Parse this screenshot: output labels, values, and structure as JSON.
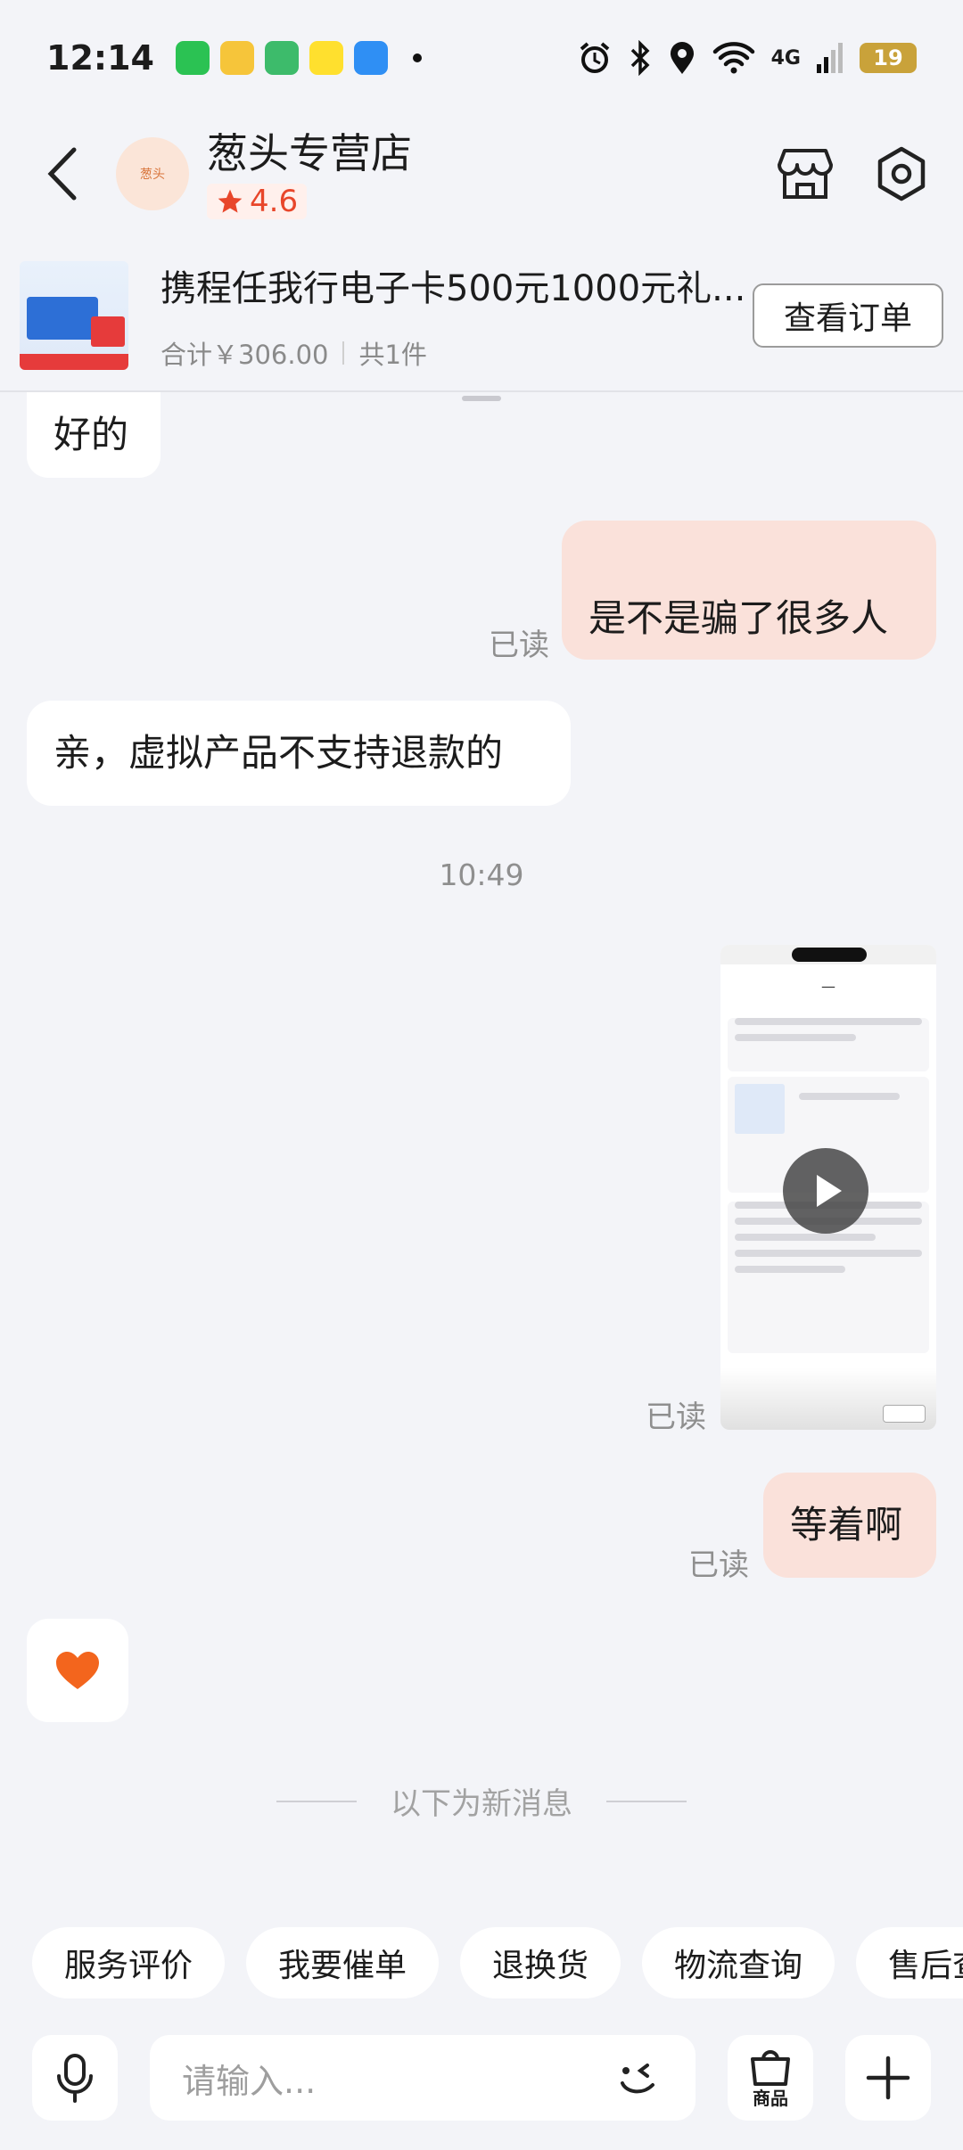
{
  "status_bar": {
    "time": "12:14",
    "network": "4G",
    "battery": "19"
  },
  "header": {
    "shop_name": "葱头专营店",
    "rating": "4.6",
    "avatar_text": "葱头"
  },
  "order": {
    "title": "携程任我行电子卡500元1000元礼...",
    "total": "合计￥306.00",
    "count": "共1件",
    "view_button": "查看订单"
  },
  "messages": {
    "m1": "好的",
    "m2": "是不是骗了很多人",
    "m2_status": "已读",
    "m3": "亲，虚拟产品不支持退款的",
    "timestamp": "10:49",
    "video_status": "已读",
    "m5": "等着啊",
    "m5_status": "已读",
    "new_messages_divider": "以下为新消息"
  },
  "quick_replies": [
    "服务评价",
    "我要催单",
    "退换货",
    "物流查询",
    "售后查询"
  ],
  "input": {
    "placeholder": "请输入...",
    "goods_label": "商品"
  },
  "colors": {
    "accent": "#e8462a",
    "bubble_self": "#fae1da",
    "heart": "#f3651d"
  }
}
